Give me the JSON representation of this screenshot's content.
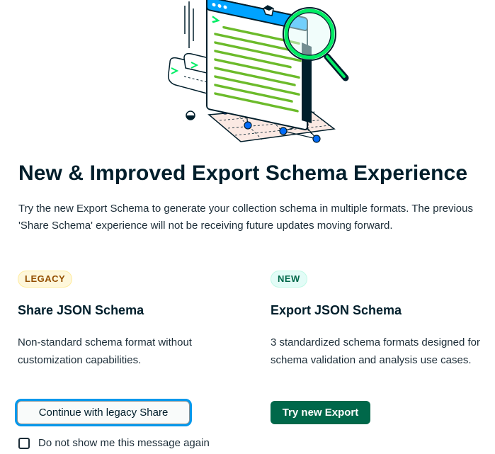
{
  "illustration": {
    "icon": "schema-magnifier-illustration"
  },
  "title": "New & Improved Export Schema Experience",
  "description": "Try the new Export Schema to generate your collection schema in multiple formats. The previous 'Share Schema' experience will not be receiving future updates moving forward.",
  "legacy": {
    "badge": "LEGACY",
    "heading": "Share JSON Schema",
    "description": "Non-standard schema format without customization capabilities.",
    "button_label": "Continue with legacy Share"
  },
  "new": {
    "badge": "NEW",
    "heading": "Export JSON Schema",
    "description": "3 standardized schema formats designed for schema validation and analysis use cases.",
    "button_label": "Try new Export"
  },
  "checkbox": {
    "label": "Do not show me this message again",
    "checked": false
  },
  "colors": {
    "primary_green": "#00684a",
    "focus_ring": "#0498ec",
    "legacy_badge_text": "#944f01",
    "new_badge_text": "#00684a"
  }
}
